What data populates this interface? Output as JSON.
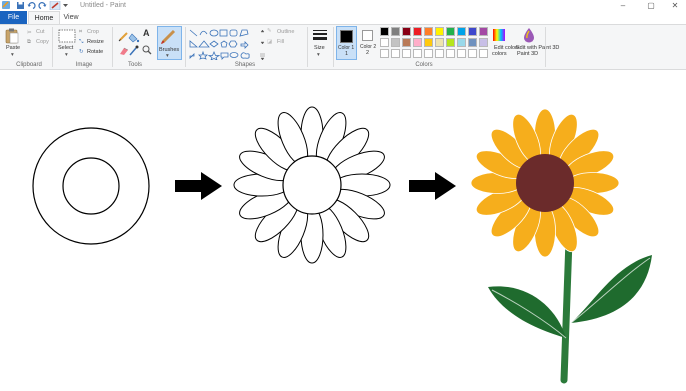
{
  "window": {
    "title": "Untitled - Paint",
    "minimize_glyph": "–",
    "maximize_glyph": "▢",
    "close_glyph": "✕"
  },
  "tabs": {
    "file": "File",
    "home": "Home",
    "view": "View"
  },
  "clipboard": {
    "paste": "Paste",
    "cut": "Cut",
    "copy": "Copy",
    "group": "Clipboard"
  },
  "image": {
    "select": "Select",
    "crop": "Crop",
    "resize": "Resize",
    "rotate": "Rotate",
    "group": "Image"
  },
  "tools": {
    "group": "Tools",
    "text_glyph": "A"
  },
  "brushes": {
    "label": "Brushes"
  },
  "shapes": {
    "outline": "Outline",
    "fill": "Fill",
    "group": "Shapes"
  },
  "size": {
    "label": "Size"
  },
  "colors": {
    "color1": "Color 1",
    "color1_short": "1",
    "color2": "Color 2",
    "color2_short": "2",
    "edit_colors": "Edit colors",
    "edit_colors_short": "colors",
    "edit_paint3d": "Edit with Paint 3D",
    "edit_paint3d_short": "Paint 3D",
    "group": "Colors",
    "color1_value": "#000000",
    "color2_value": "#ffffff",
    "palette_row1": [
      "#000000",
      "#7f7f7f",
      "#880015",
      "#ed1c24",
      "#ff7f27",
      "#fff200",
      "#22b14c",
      "#00a2e8",
      "#3f48cc",
      "#a349a4"
    ],
    "palette_row2": [
      "#ffffff",
      "#c3c3c3",
      "#b97a57",
      "#ffaec9",
      "#ffc90e",
      "#efe4b0",
      "#b5e61d",
      "#99d9ea",
      "#7092be",
      "#c8bfe7"
    ]
  },
  "drawing": {
    "petal_fill": "#f6ae1c",
    "center_fill": "#6b2b2b",
    "stem_color": "#2b7a3a",
    "leaf_color": "#1f6b2e"
  }
}
